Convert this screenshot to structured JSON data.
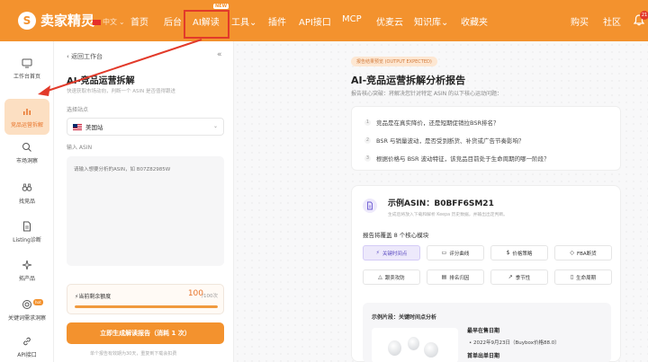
{
  "topbar": {
    "logo_text": "卖家精灵",
    "lang": "中文",
    "nav": [
      "首页",
      "后台",
      "AI解读",
      "工具",
      "插件",
      "API接口",
      "MCP",
      "优麦云",
      "知识库",
      "收藏夹"
    ],
    "new_badge": "NEW",
    "right": [
      "购买",
      "社区"
    ],
    "bell_count": "21"
  },
  "sidebar": {
    "items": [
      "工作台首页",
      "竞品运营拆解",
      "市场洞察",
      "找竞品",
      "Listing诊断",
      "拓产品",
      "关键词需求洞察",
      "API接口"
    ],
    "hot_badge": "hot"
  },
  "panel": {
    "back": "返回工作台",
    "title": "AI-竞品运营拆解",
    "subtitle": "快速获取市场动向，判断一个 ASIN 是否值得跟进",
    "site_label": "选择站点",
    "site_value": "美国站",
    "asin_label": "输入 ASIN",
    "asin_placeholder": "请输入想要分析的ASIN，如 B07Z82985W",
    "quota_label": "⚡当前剩余额度",
    "quota_value": "100",
    "quota_total": "/100次",
    "quota_ratio": 1.0,
    "generate_button": "立即生成解读报告（消耗 1 次）",
    "footnote": "单个报告有效期为30天，重复到下载会扣费"
  },
  "main": {
    "pill": "报告结果预览 (OUTPUT EXPECTED)",
    "title": "AI-竞品运营拆解分析报告",
    "subtitle": "报告核心突破：将解决您针对特定 ASIN 的以下核心运动问题：",
    "questions": [
      "竞品是在真实降价，还是短期促销拉BSR排名？",
      "BSR 与销量波动，是否受到断货、补货或广告节奏影响？",
      "根据价格与 BSR 波动特征，该竞品目前处于生命周期的哪一阶段？"
    ],
    "example": {
      "title": "示例ASIN：B0BFF6SM21",
      "subtitle": "生成后将放入下载和解析 Keepa 历史数据，并输出出定判断。",
      "cover_label": "报告将覆盖 8 个核心模块",
      "modules": [
        "关键时间点",
        "评分曲线",
        "价格策略",
        "FBA断货",
        "跟卖攻防",
        "排名归因",
        "季节性",
        "生命周期"
      ],
      "snippet_title": "示例片段：关键时间点分析",
      "snippet_h1": "最早在售日期",
      "snippet_item": "• 2022年9月23日（Buybox价格88.0）",
      "snippet_h2": "首单出单日期"
    }
  }
}
